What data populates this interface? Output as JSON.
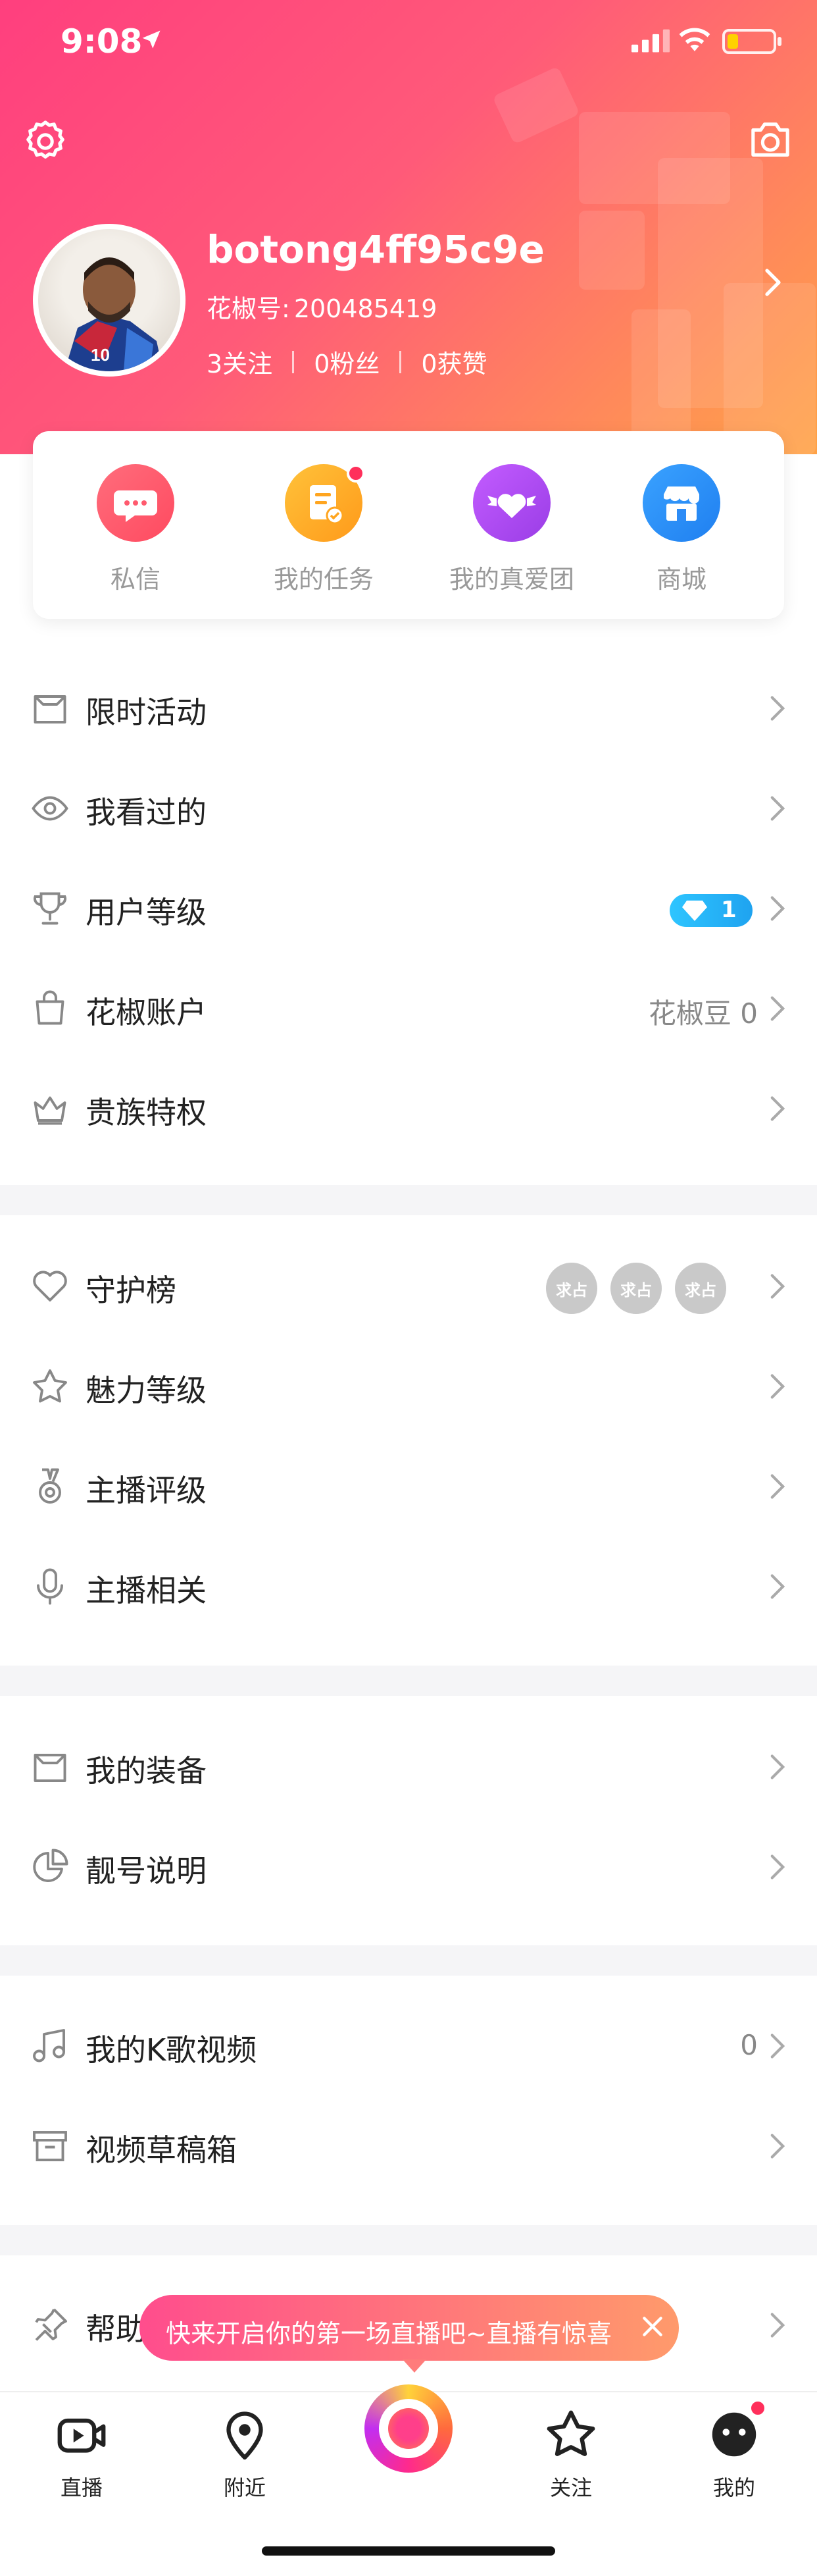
{
  "status_bar": {
    "time": "9:08"
  },
  "profile": {
    "username": "botong4ff95c9e",
    "id_label": "花椒号:",
    "id_value": "200485419",
    "following": "3关注",
    "fans": "0粉丝",
    "likes": "0获赞"
  },
  "quick_actions": [
    {
      "label": "私信",
      "icon": "message-icon",
      "color": "#ff5a6e"
    },
    {
      "label": "我的任务",
      "icon": "task-icon",
      "color": "#ffa51f",
      "badge": true
    },
    {
      "label": "我的真爱团",
      "icon": "heart-wings-icon",
      "color": "#b44cf0"
    },
    {
      "label": "商城",
      "icon": "shop-icon",
      "color": "#2d8cf6"
    }
  ],
  "menu_group1": [
    {
      "label": "限时活动",
      "icon": "box-icon"
    },
    {
      "label": "我看过的",
      "icon": "eye-icon"
    },
    {
      "label": "用户等级",
      "icon": "trophy-icon",
      "level": "1"
    },
    {
      "label": "花椒账户",
      "icon": "bag-icon",
      "value": "花椒豆 0"
    },
    {
      "label": "贵族特权",
      "icon": "crown-icon"
    }
  ],
  "menu_group2": [
    {
      "label": "守护榜",
      "icon": "heart-outline-icon",
      "guards": [
        "求占",
        "求占",
        "求占"
      ]
    },
    {
      "label": "魅力等级",
      "icon": "star-outline-icon"
    },
    {
      "label": "主播评级",
      "icon": "medal-icon"
    },
    {
      "label": "主播相关",
      "icon": "mic-icon"
    }
  ],
  "menu_group3": [
    {
      "label": "我的装备",
      "icon": "box-icon"
    },
    {
      "label": "靓号说明",
      "icon": "pie-icon"
    }
  ],
  "menu_group4": [
    {
      "label": "我的K歌视频",
      "icon": "music-icon",
      "value": "0"
    },
    {
      "label": "视频草稿箱",
      "icon": "archive-icon"
    }
  ],
  "menu_group5": [
    {
      "label": "帮助",
      "icon": "pin-icon"
    }
  ],
  "tooltip": {
    "text": "快来开启你的第一场直播吧~直播有惊喜"
  },
  "tabbar": [
    {
      "label": "直播",
      "icon": "video-icon"
    },
    {
      "label": "附近",
      "icon": "location-icon"
    },
    {
      "label": "",
      "icon": "live-start-icon"
    },
    {
      "label": "关注",
      "icon": "star-icon"
    },
    {
      "label": "我的",
      "icon": "face-icon"
    }
  ],
  "colors": {
    "accent": "#ff3f7e",
    "gradient_end": "#ffa347",
    "badge_red": "#ff2f5b",
    "level_blue": "#1fa3f0"
  }
}
